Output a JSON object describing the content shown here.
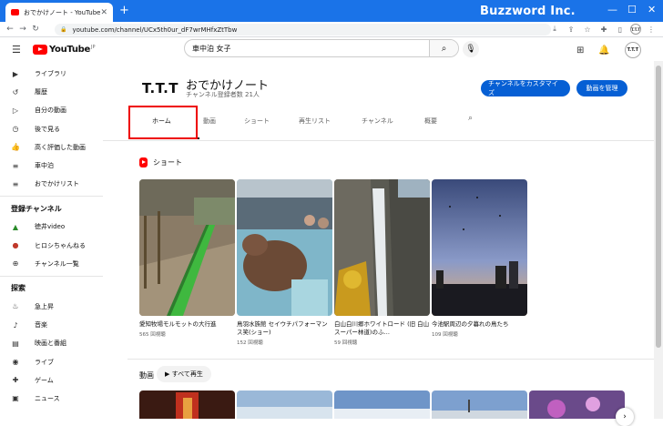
{
  "browser": {
    "tab_title": "おでかけノート - YouTube",
    "new_tab": "+",
    "brand": "Buzzword Inc.",
    "url": "youtube.com/channel/UCx5th0ur_dF7wrMHfxZtTbw",
    "profile": "T.T.T"
  },
  "masthead": {
    "logo": "YouTube",
    "logo_suffix": "JP",
    "search_query": "車中泊 女子",
    "avatar": "T.T.T"
  },
  "sidebar": {
    "items": [
      {
        "icon": "library-icon",
        "glyph": "▶",
        "label": "ライブラリ"
      },
      {
        "icon": "history-icon",
        "glyph": "↺",
        "label": "履歴"
      },
      {
        "icon": "your-videos-icon",
        "glyph": "▷",
        "label": "自分の動画"
      },
      {
        "icon": "watch-later-icon",
        "glyph": "◷",
        "label": "後で見る"
      },
      {
        "icon": "liked-icon",
        "glyph": "👍",
        "label": "高く評価した動画"
      },
      {
        "icon": "playlist-icon",
        "glyph": "≡",
        "label": "車中泊"
      },
      {
        "icon": "playlist-icon",
        "glyph": "≡",
        "label": "おでかけリスト"
      }
    ],
    "subs_heading": "登録チャンネル",
    "subs": [
      {
        "icon": "channel-avatar-icon",
        "glyph": "▲",
        "label": "徳井video"
      },
      {
        "icon": "channel-avatar-icon",
        "glyph": "●",
        "label": "ヒロシちゃんねる"
      },
      {
        "icon": "all-channels-icon",
        "glyph": "⊕",
        "label": "チャンネル一覧"
      }
    ],
    "explore_heading": "探索",
    "explore": [
      {
        "icon": "trending-icon",
        "glyph": "♨",
        "label": "急上昇"
      },
      {
        "icon": "music-icon",
        "glyph": "♪",
        "label": "音楽"
      },
      {
        "icon": "movies-icon",
        "glyph": "▤",
        "label": "映画と番組"
      },
      {
        "icon": "live-icon",
        "glyph": "◉",
        "label": "ライブ"
      },
      {
        "icon": "gaming-icon",
        "glyph": "✚",
        "label": "ゲーム"
      },
      {
        "icon": "news-icon",
        "glyph": "▣",
        "label": "ニュース"
      }
    ]
  },
  "channel": {
    "logo": "T.T.T",
    "name": "おでかけノート",
    "subscribers": "チャンネル登録者数 21人",
    "customize_button": "チャンネルをカスタマイズ",
    "manage_button": "動画を管理"
  },
  "tabs": [
    "ホーム",
    "動画",
    "ショート",
    "再生リスト",
    "チャンネル",
    "概要"
  ],
  "shorts": {
    "heading": "ショート",
    "items": [
      {
        "title": "愛知牧場モルモットの大行進",
        "views": "565 回視聴"
      },
      {
        "title": "鳥羽水族館 セイウチパフォーマンス笑(ショー)",
        "views": "152 回視聴"
      },
      {
        "title": "白山白川郷ホワイトロード (旧 白山スーパー林道)のふ…",
        "views": "59 回視聴"
      },
      {
        "title": "今池駅周辺の夕暮れの鳥たち",
        "views": "109 回視聴"
      }
    ]
  },
  "videos": {
    "heading": "動画",
    "play_all": "▶ すべて再生"
  }
}
